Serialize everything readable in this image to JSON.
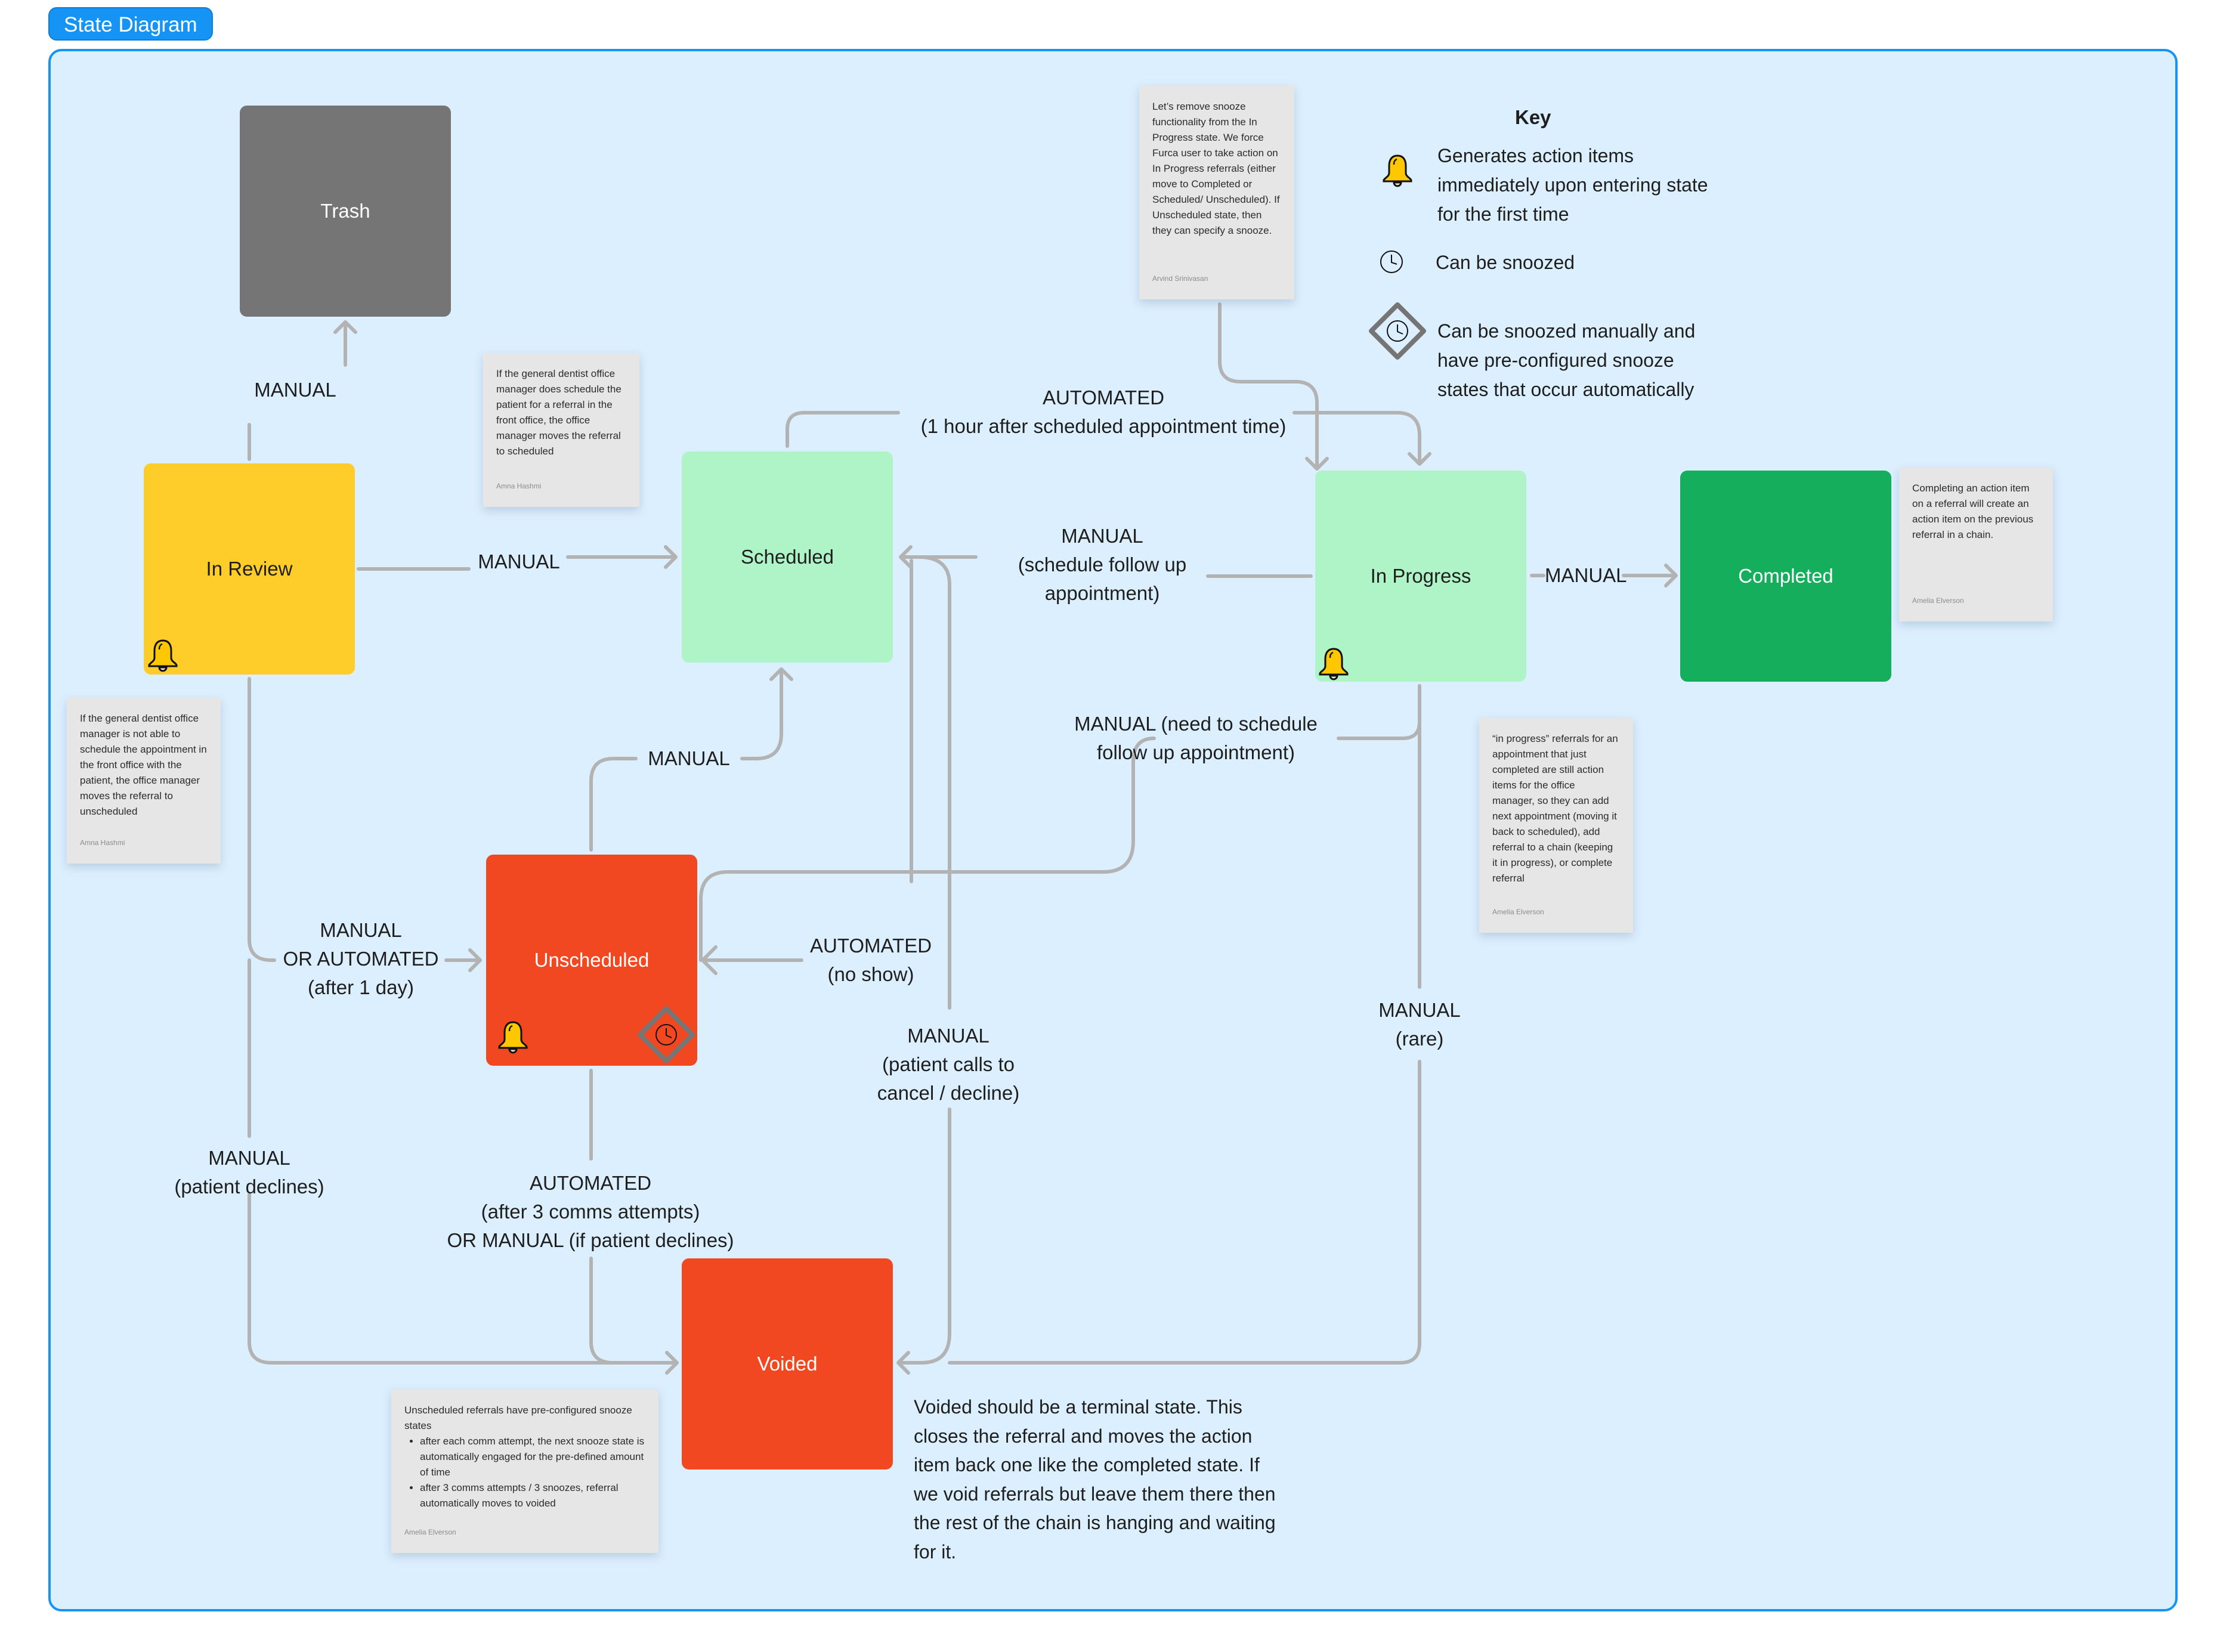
{
  "title": "State Diagram",
  "colors": {
    "frame_border": "#1594f5",
    "frame_fill": "#dcefff",
    "trash": "#757575",
    "in_review": "#ffcd29",
    "light_green": "#aff4c6",
    "completed": "#14ae5c",
    "red_state": "#f24822",
    "connector": "#b3b3b3",
    "sticky": "#e6e6e6"
  },
  "states": {
    "trash": "Trash",
    "in_review": "In Review",
    "scheduled": "Scheduled",
    "in_progress": "In Progress",
    "completed": "Completed",
    "unscheduled": "Unscheduled",
    "voided": "Voided"
  },
  "state_icons": {
    "in_review": [
      "bell-icon"
    ],
    "in_progress": [
      "bell-icon"
    ],
    "unscheduled": [
      "bell-icon",
      "snooze-diamond-icon"
    ]
  },
  "transitions": [
    {
      "from": "In Review",
      "to": "Trash",
      "label": [
        "MANUAL"
      ]
    },
    {
      "from": "In Review",
      "to": "Scheduled",
      "label": [
        "MANUAL"
      ]
    },
    {
      "from": "Scheduled",
      "to": "In Progress",
      "label": [
        "AUTOMATED",
        "(1 hour after scheduled appointment time)"
      ]
    },
    {
      "from": "In Progress",
      "to": "Scheduled",
      "label": [
        "MANUAL",
        "(schedule follow up",
        "appointment)"
      ]
    },
    {
      "from": "In Progress",
      "to": "Completed",
      "label": [
        "MANUAL"
      ]
    },
    {
      "from": "In Progress",
      "to": "Unscheduled",
      "label": [
        "MANUAL (need to schedule",
        "follow up appointment)"
      ]
    },
    {
      "from": "Unscheduled",
      "to": "Scheduled",
      "label": [
        "MANUAL"
      ]
    },
    {
      "from": "In Review",
      "to": "Unscheduled",
      "label": [
        "MANUAL",
        "OR AUTOMATED",
        "(after 1 day)"
      ]
    },
    {
      "from": "Scheduled",
      "to": "Unscheduled",
      "label": [
        "AUTOMATED",
        "(no show)"
      ]
    },
    {
      "from": "Scheduled",
      "to": "Voided",
      "label": [
        "MANUAL",
        "(patient calls to",
        "cancel / decline)"
      ]
    },
    {
      "from": "In Progress",
      "to": "Voided",
      "label": [
        "MANUAL",
        "(rare)"
      ]
    },
    {
      "from": "In Review",
      "to": "Voided",
      "label": [
        "MANUAL",
        "(patient declines)"
      ]
    },
    {
      "from": "Unscheduled",
      "to": "Voided",
      "label": [
        "AUTOMATED",
        "(after 3 comms attempts)",
        "OR MANUAL (if patient declines)"
      ]
    }
  ],
  "key": {
    "title": "Key",
    "items": [
      {
        "icon": "bell-icon",
        "text": [
          "Generates action items",
          "immediately upon entering state",
          "for the first time"
        ]
      },
      {
        "icon": "clock-icon",
        "text": [
          "Can be snoozed"
        ]
      },
      {
        "icon": "snooze-diamond-icon",
        "text": [
          "Can be snoozed manually and",
          "have pre-configured snooze",
          "states that occur automatically"
        ]
      }
    ]
  },
  "stickies": [
    {
      "id": "remove-snooze",
      "text": "Let’s remove snooze functionality from the In Progress state. We force Furca user to take action on In Progress referrals (either move to Completed or Scheduled/ Unscheduled). If Unscheduled state, then they can specify a snooze.",
      "author": "Arvind Srinivasan"
    },
    {
      "id": "does-schedule",
      "text": "If the general dentist office manager does schedule the patient for a referral in the front office, the office manager moves the referral to scheduled",
      "author": "Amna Hashmi"
    },
    {
      "id": "not-able",
      "text": "If the general dentist office manager is not able to schedule the appointment in the front office with the patient, the office manager moves the referral to unscheduled",
      "author": "Amna Hashmi"
    },
    {
      "id": "completing",
      "text": "Completing an action item on a referral will create an action item on the previous referral in a chain.",
      "author": "Amelia Elverson"
    },
    {
      "id": "in-progress-note",
      "text": "“in progress” referrals for an appointment that just completed are still action items for the office manager,  so they can add next appointment (moving it back to scheduled), add referral to a chain (keeping it in progress), or complete referral",
      "author": "Amelia Elverson"
    },
    {
      "id": "unscheduled-note",
      "text": "Unscheduled referrals have pre-configured snooze states",
      "bullets": [
        "after each comm attempt, the next snooze state is automatically engaged for the pre-defined amount of time",
        "after 3 comms attempts / 3 snoozes, referral automatically moves to voided"
      ],
      "author": "Amelia Elverson"
    }
  ],
  "voided_note": "Voided should be a terminal state. This closes the referral and moves the action item back one like the completed state. If we void referrals but leave them there then the rest of the chain is hanging and waiting for it."
}
